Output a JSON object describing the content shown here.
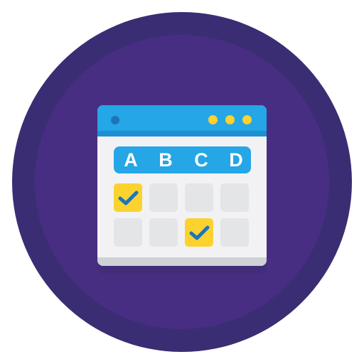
{
  "colors": {
    "outer_circle": "#3b2d73",
    "inner_circle": "#472e82",
    "titlebar": "#25a6e6",
    "accent_yellow": "#fcd22f",
    "check_blue": "#1b75bb",
    "cell_gray": "#e4e5e7",
    "window_body": "#f2f2f4"
  },
  "window": {
    "titlebar_dots": [
      "blue-dot",
      "yellow-dot",
      "yellow-dot",
      "yellow-dot"
    ]
  },
  "grid": {
    "columns": [
      "A",
      "B",
      "C",
      "D"
    ],
    "rows": [
      [
        true,
        false,
        false,
        false
      ],
      [
        false,
        false,
        true,
        false
      ]
    ]
  }
}
